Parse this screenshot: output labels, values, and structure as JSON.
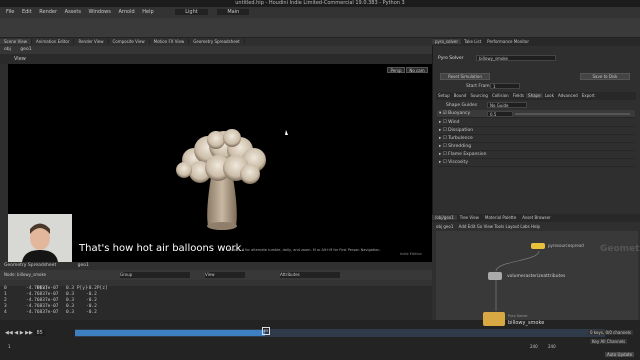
{
  "window_title": "untitled.hip - Houdini Indie Limited-Commercial 19.0.383 - Python 3",
  "menu": [
    "File",
    "Edit",
    "Render",
    "Assets",
    "Windows",
    "Arnold",
    "Help"
  ],
  "desktop": "Light",
  "mode": "Main",
  "left_tabs": [
    "Scene View",
    "Animation Editor",
    "Render View",
    "Composite View",
    "Motion FX View",
    "Geometry Spreadsheet"
  ],
  "path": "obj",
  "node_path": "geo1",
  "view_label": "View",
  "viewport": {
    "camera": "Persp",
    "cam_menu": "No cam",
    "subtitle": "That's how hot air balloons work.",
    "hint": "Press 1-4 for alternate tumble, dolly, and zoom.   M or Alt+M for First Person Navigation.",
    "watermark": "Indie Edition"
  },
  "spreadsheet": {
    "title": "Geometry Spreadsheet",
    "node": "geo1",
    "nodes_label": "Node: billowy_smoke",
    "group_label": "Group",
    "view_label": "View",
    "attributes_label": "Attributes",
    "columns": [
      "",
      "P[x]",
      "P[y]",
      "P[z]"
    ],
    "rows": [
      [
        "0",
        "-4.76837e-07",
        "0.3",
        "-0.2"
      ],
      [
        "1",
        "-4.76837e-07",
        "0.3",
        "-0.2"
      ],
      [
        "2",
        "-4.76837e-07",
        "0.3",
        "-0.2"
      ],
      [
        "3",
        "-4.76837e-07",
        "0.3",
        "-0.2"
      ],
      [
        "4",
        "-4.76837e-07",
        "0.3",
        "-0.2"
      ]
    ]
  },
  "timeline": {
    "frame": "1",
    "current": "85",
    "start": "1",
    "end": "240",
    "end2": "240",
    "keys_label": "0 keys, 0/0 channels",
    "key_all": "Key All Channels",
    "auto_update": "Auto Update"
  },
  "right_panel": {
    "tabs": [
      "pyro_solver",
      "Take List",
      "Performance Monitor"
    ],
    "node_type": "Pyro Solver",
    "node_name": "billowy_smoke",
    "reset_simulation": "Reset Simulation",
    "save_to_disk": "Save to Disk",
    "initial_state_label": "Initial State",
    "start_frame_label": "Start Frame",
    "start_frame_value": "1",
    "param_tabs": [
      "Setup",
      "Bound",
      "Sourcing",
      "Collision",
      "Fields",
      "Shape",
      "Look",
      "Advanced",
      "Export"
    ],
    "shape_guides_label": "Shape Guides",
    "shape_guides_value": "No Guide",
    "params": [
      {
        "label": "Buoyancy",
        "value": "0.5",
        "checked": true
      },
      {
        "label": "Wind",
        "value": "",
        "checked": false
      },
      {
        "label": "Dissipation",
        "value": "",
        "checked": false
      },
      {
        "label": "Turbulence",
        "value": "",
        "checked": false
      },
      {
        "label": "Shredding",
        "value": "",
        "checked": false
      },
      {
        "label": "Flame Expansion",
        "value": "",
        "checked": false
      },
      {
        "label": "Viscosity",
        "value": "",
        "checked": false
      }
    ]
  },
  "network": {
    "tabs": [
      "/obj/geo1",
      "Tree View",
      "Material Palette",
      "Asset Browser"
    ],
    "path": "obj",
    "node": "geo1",
    "menu": [
      "Add",
      "Edit",
      "Go",
      "View",
      "Tools",
      "Layout",
      "Labs",
      "Help"
    ],
    "context": "Geometry",
    "nodes": [
      "pyrosourcespread",
      "volumerasterizeattributes",
      "billowy_smoke"
    ],
    "pyro_label": "Pyro Solver"
  },
  "colors": {
    "accent": "#3d7fc1",
    "node_yellow": "#e8c23a"
  }
}
